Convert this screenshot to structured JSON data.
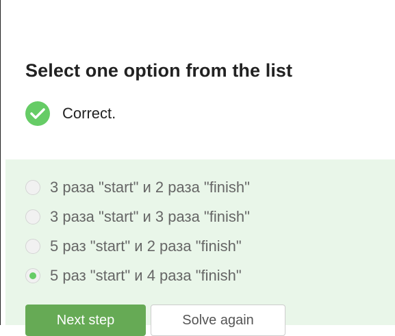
{
  "question": {
    "title": "Select one option from the list"
  },
  "feedback": {
    "icon": "checkmark-icon",
    "text": "Correct.",
    "color": "#66cc66"
  },
  "options": [
    {
      "label": "3 раза \"start\" и 2 раза \"finish\"",
      "selected": false
    },
    {
      "label": "3 раза \"start\" и 3 раза \"finish\"",
      "selected": false
    },
    {
      "label": "5 раз \"start\" и 2 раза \"finish\"",
      "selected": false
    },
    {
      "label": "5 раз \"start\" и 4 раза \"finish\"",
      "selected": true
    }
  ],
  "buttons": {
    "next_label": "Next step",
    "solve_again_label": "Solve again"
  },
  "colors": {
    "panel_bg": "#e9f6e9",
    "accent": "#66cc66",
    "next_button": "#66aa55"
  }
}
